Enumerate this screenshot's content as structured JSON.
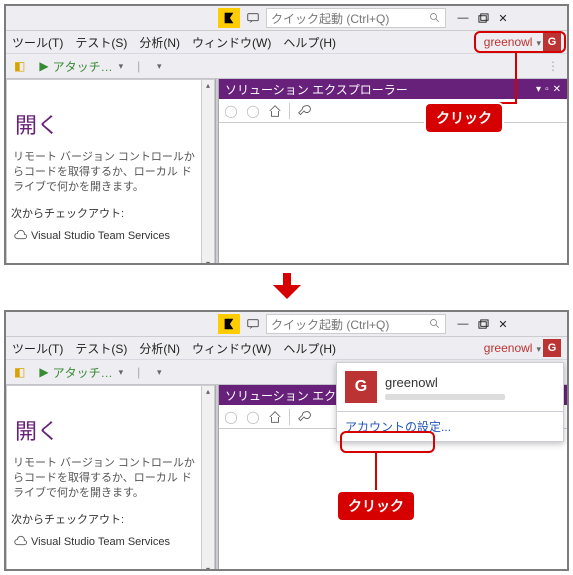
{
  "quicklaunch_placeholder": "クイック起動 (Ctrl+Q)",
  "menus": {
    "tool": "ツール(T)",
    "test": "テスト(S)",
    "analyze": "分析(N)",
    "window": "ウィンドウ(W)",
    "help": "ヘルプ(H)"
  },
  "user": {
    "name": "greenowl",
    "initial": "G"
  },
  "toolbar": {
    "attach": "アタッチ…"
  },
  "left_panel": {
    "open": "開く",
    "desc": "リモート バージョン コントロールからコードを取得するか、ローカル ドライブで何かを開きます。",
    "checkout_label": "次からチェックアウト:",
    "vsts": "Visual Studio Team Services"
  },
  "solution_explorer": {
    "title": "ソリューション エクスプローラー",
    "title_short": "ソリューション エクス"
  },
  "account_popup": {
    "settings": "アカウントの設定..."
  },
  "badges": {
    "click": "クリック"
  }
}
